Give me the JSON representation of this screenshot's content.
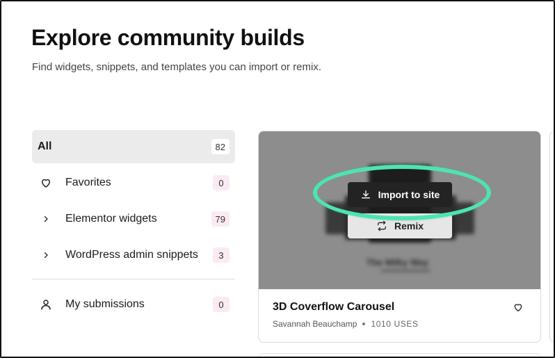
{
  "header": {
    "title": "Explore community builds",
    "subtitle": "Find widgets, snippets, and templates you can import or remix."
  },
  "sidebar": {
    "items": [
      {
        "label": "All",
        "count": "82",
        "icon": "none",
        "active": true
      },
      {
        "label": "Favorites",
        "count": "0",
        "icon": "heart-icon"
      },
      {
        "label": "Elementor widgets",
        "count": "79",
        "icon": "chevron-right-icon"
      },
      {
        "label": "WordPress admin snippets",
        "count": "3",
        "icon": "chevron-right-icon"
      }
    ],
    "submissions": {
      "label": "My submissions",
      "count": "0",
      "icon": "user-icon"
    }
  },
  "card": {
    "title": "3D Coverflow Carousel",
    "author": "Savannah Beauchamp",
    "uses": "1010 USES",
    "import_label": "Import to site",
    "remix_label": "Remix",
    "preview_caption": "The Milky Way"
  },
  "colors": {
    "highlight": "#4ee3b5",
    "badge_bg": "#fbeaf3",
    "active_bg": "#ebebeb",
    "import_bg": "#232323"
  }
}
